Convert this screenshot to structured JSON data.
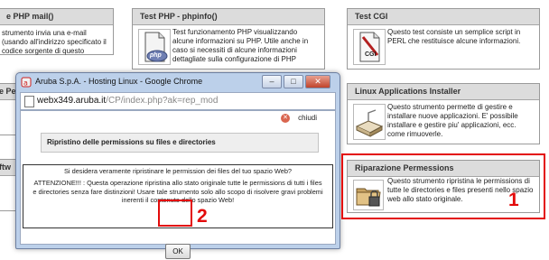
{
  "panels": {
    "mail": {
      "title": "e PHP mail()",
      "desc": "strumento invia una e-mail (usando all'indirizzo specificato il codice sorgente di questo"
    },
    "phpinfo": {
      "title": "Test PHP - phpinfo()",
      "desc": "Test funzionamento PHP visualizzando alcune informazioni su PHP. Utile anche in caso si necessiti di alcune informazioni dettagliate sulla configurazione di PHP",
      "icon_text": "php"
    },
    "cgi": {
      "title": "Test CGI",
      "desc": "Questo test consiste un semplice script in PERL che restituisce alcune informazioni.",
      "icon_text": "CGI"
    },
    "left_mid": {
      "title": "e Pe"
    },
    "left_low": {
      "title": "ftw"
    },
    "linux_installer": {
      "title": "Linux Applications Installer",
      "desc": "Questo strumento permette di gestire e installare nuove applicazioni. E' possibile installare e gestire piu' applicazioni, ecc. come rimuoverle."
    },
    "riparazione": {
      "title": "Riparazione Permessions",
      "desc": "Questo strumento ripristina le permissions di tutte le directories e files presenti nello spazio web allo stato originale."
    }
  },
  "popup": {
    "window_title": "Aruba S.p.A. - Hosting Linux - Google Chrome",
    "url_host": "webx349.aruba.it",
    "url_path": "/CP/index.php?ak=rep_mod",
    "close_label": "chiudi",
    "heading": "Ripristino delle permissions su files e directories",
    "question": "Si desidera veramente ripristinare le permission dei files del tuo spazio Web?",
    "warning": "ATTENZIONE!!! : Questa operazione ripristina allo stato originale tutte le permissions di tutti i files e directories senza fare distinzioni! Usare tale strumento solo allo scopo di risolvere gravi problemi inerenti il contenuto dello spazio Web!",
    "ok_label": "OK",
    "win_buttons": {
      "minimize": "–",
      "maximize": "□",
      "close": "✕"
    }
  },
  "annotations": {
    "step1": "1",
    "step2": "2",
    "color": "#e30b0b"
  }
}
